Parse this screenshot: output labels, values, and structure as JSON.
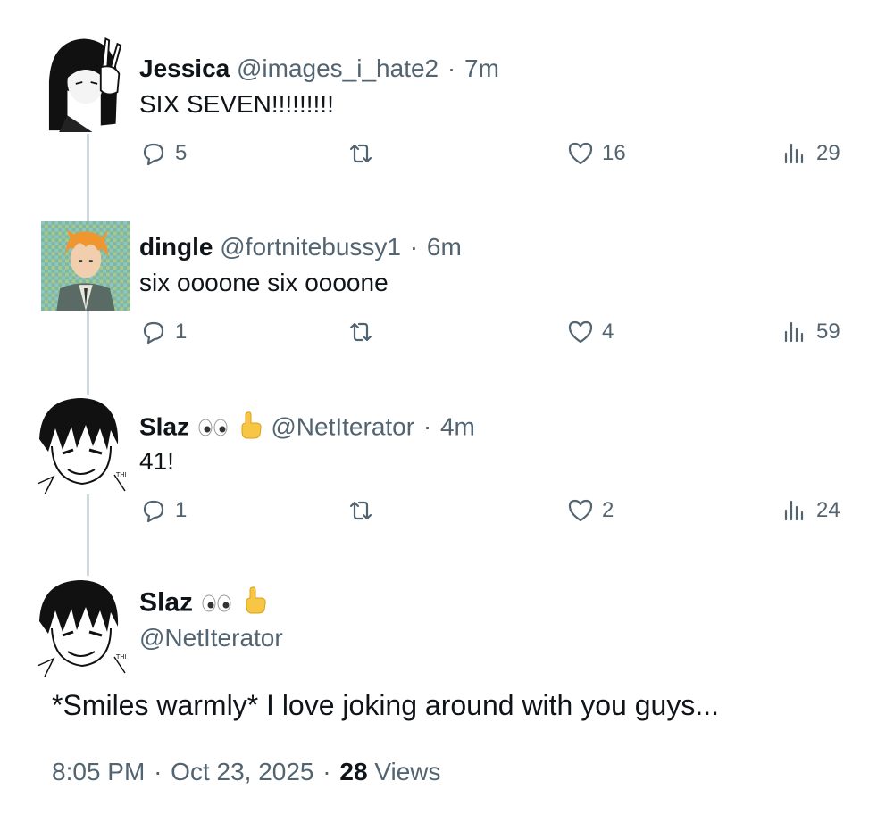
{
  "replies": [
    {
      "display_name": "Jessica",
      "handle": "@images_i_hate2",
      "separator": "·",
      "time": "7m",
      "text": "SIX SEVEN!!!!!!!!!",
      "reply_count": "5",
      "like_count": "16",
      "view_count": "29",
      "avatar_icon": "anime-girl-peace-sign-avatar"
    },
    {
      "display_name": "dingle",
      "handle": "@fortnitebussy1",
      "separator": "·",
      "time": "6m",
      "text": "six oooone six oooone",
      "reply_count": "1",
      "like_count": "4",
      "view_count": "59",
      "avatar_icon": "orange-hair-character-avatar"
    },
    {
      "display_name": "Slaz",
      "handle": "@NetIterator",
      "separator": "·",
      "time": "4m",
      "text": "41!",
      "reply_count": "1",
      "like_count": "2",
      "view_count": "24",
      "avatar_icon": "manga-boy-smiling-avatar"
    }
  ],
  "main_post": {
    "display_name": "Slaz",
    "handle": "@NetIterator",
    "text": "*Smiles warmly* I love joking around with you guys...",
    "time": "8:05 PM",
    "separator": "·",
    "date": "Oct 23, 2025",
    "views_count": "28",
    "views_label": "Views",
    "avatar_icon": "manga-boy-smiling-avatar"
  },
  "colors": {
    "text_primary": "#0f1419",
    "text_secondary": "#536471",
    "thread_line": "#cfd9de",
    "emoji_hand": "#f7c644"
  }
}
